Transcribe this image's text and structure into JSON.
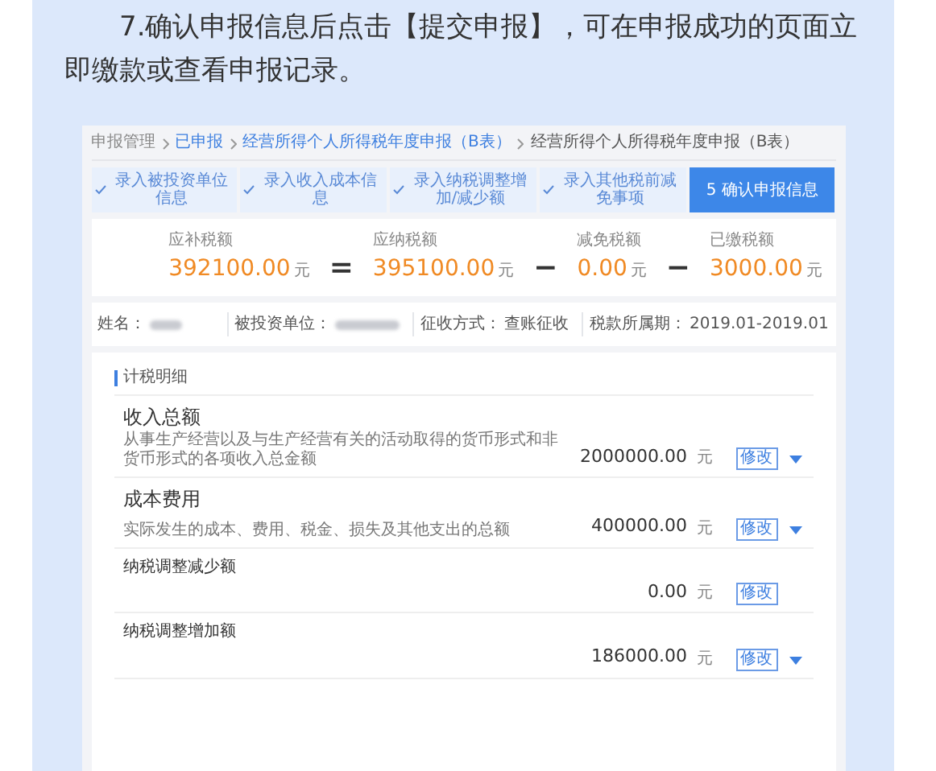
{
  "article": {
    "paragraph": "7.确认申报信息后点击【提交申报】，可在申报成功的页面立即缴款或查看申报记录。"
  },
  "breadcrumb": [
    {
      "label": "申报管理",
      "selected": false
    },
    {
      "label": "已申报",
      "selected": false
    },
    {
      "label": "经营所得个人所得税年度申报（B表）",
      "selected": false
    },
    {
      "label": "经营所得个人所得税年度申报（B表）",
      "selected": true
    }
  ],
  "steps": [
    {
      "label": "录入被投资单位信息",
      "done": true,
      "selected": false
    },
    {
      "label": "录入收入成本信息",
      "done": true,
      "selected": false
    },
    {
      "label": "录入纳税调整增加/减少额",
      "done": true,
      "selected": false
    },
    {
      "label": "录入其他税前减免事项",
      "done": true,
      "selected": false
    },
    {
      "label": "5 确认申报信息",
      "done": false,
      "selected": true
    }
  ],
  "summary": [
    {
      "kind": "amount",
      "label": "应补税额",
      "value": "392100.00",
      "unit": "元"
    },
    {
      "kind": "operator",
      "symbol": "="
    },
    {
      "kind": "amount",
      "label": "应纳税额",
      "value": "395100.00",
      "unit": "元"
    },
    {
      "kind": "operator",
      "symbol": "−"
    },
    {
      "kind": "amount",
      "label": "减免税额",
      "value": "0.00",
      "unit": "元"
    },
    {
      "kind": "operator",
      "symbol": "−"
    },
    {
      "kind": "amount",
      "label": "已缴税额",
      "value": "3000.00",
      "unit": "元"
    }
  ],
  "info": [
    {
      "label": "姓名：",
      "redacted": true
    },
    {
      "label": "被投资单位：",
      "redacted": true
    },
    {
      "label": "征收方式：",
      "value": "查账征收",
      "redacted": false
    },
    {
      "label": "税款所属期：",
      "value": "2019.01-2019.01",
      "redacted": false
    }
  ],
  "details": {
    "title": "计税明细",
    "rows": [
      {
        "name": "收入总额",
        "description": "从事生产经营以及与生产经营有关的活动取得的货币形式和非货币形式的各项收入总金额",
        "amount": "2000000.00",
        "unit": "元",
        "button": "修改",
        "expandable": true
      },
      {
        "name": "成本费用",
        "description": "实际发生的成本、费用、税金、损失及其他支出的总额",
        "amount": "400000.00",
        "unit": "元",
        "button": "修改",
        "expandable": true
      },
      {
        "name": "纳税调整减少额",
        "amount": "0.00",
        "unit": "元",
        "button": "修改",
        "expandable": false
      },
      {
        "name": "纳税调整增加额",
        "amount": "186000.00",
        "unit": "元",
        "button": "修改",
        "expandable": true
      }
    ]
  }
}
